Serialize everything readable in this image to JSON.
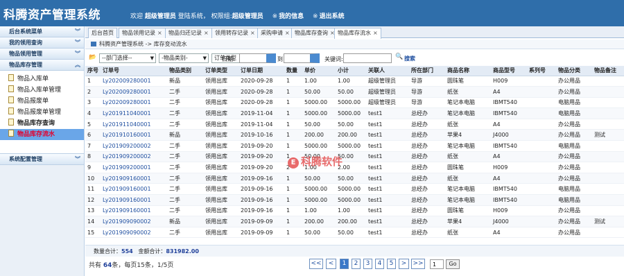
{
  "header": {
    "title": "科腾资产管理系统",
    "welcome": "欢迎",
    "username": "超级管理员",
    "login_text": "登陆系统，",
    "perm_label": "权限组:",
    "perm_group": "超级管理员",
    "my_info": "我的信息",
    "logout": "退出系统"
  },
  "sidebar": {
    "menus": [
      {
        "label": "后台系统菜单"
      },
      {
        "label": "我的领用查询"
      },
      {
        "label": "物品领用管理"
      },
      {
        "label": "物品库存管理"
      }
    ],
    "items": [
      {
        "label": "物品入库单"
      },
      {
        "label": "物品入库单管理"
      },
      {
        "label": "物品报废单"
      },
      {
        "label": "物品报废单管理"
      },
      {
        "label": "物品库存查询"
      },
      {
        "label": "物品库存流水"
      }
    ],
    "footer_menu": "系统配置管理"
  },
  "tabs": [
    "后台首页",
    "物品领用记录",
    "物品归还记录",
    "领用转存记录",
    "采购申请",
    "物品库存查询",
    "物品库存流水"
  ],
  "breadcrumb": "科腾资产管理系统 -> 库存变动流水",
  "filters": {
    "dept": "--部门选择--",
    "category": "-物品类别-",
    "order_type": "订单类型",
    "date_label": "日期:",
    "to_label": "到",
    "keyword_label": "关键词:",
    "search": "搜索"
  },
  "table": {
    "columns": [
      "序号",
      "订单号",
      "物品类别",
      "订单类型",
      "订单日期",
      "数量",
      "单价",
      "小计",
      "关联人",
      "所在部门",
      "商品名称",
      "商品型号",
      "系列号",
      "物品分类",
      "物品备注"
    ],
    "rows": [
      [
        "1",
        "Ly202009280001",
        "新品",
        "领用出库",
        "2020-09-28",
        "1",
        "1.00",
        "1.00",
        "超级管理员",
        "导游",
        "圆珠笔",
        "H009",
        "",
        "办公用品",
        ""
      ],
      [
        "2",
        "Ly202009280001",
        "二手",
        "领用出库",
        "2020-09-28",
        "1",
        "50.00",
        "50.00",
        "超级管理员",
        "导游",
        "纸张",
        "A4",
        "",
        "办公用品",
        ""
      ],
      [
        "3",
        "Ly202009280001",
        "二手",
        "领用出库",
        "2020-09-28",
        "1",
        "5000.00",
        "5000.00",
        "超级管理员",
        "导游",
        "笔记本电脑",
        "IBMT540",
        "",
        "电脑用品",
        ""
      ],
      [
        "4",
        "Ly201911040001",
        "二手",
        "领用出库",
        "2019-11-04",
        "1",
        "5000.00",
        "5000.00",
        "test1",
        "总经办",
        "笔记本电脑",
        "IBMT540",
        "",
        "电脑用品",
        ""
      ],
      [
        "5",
        "Ly201911040001",
        "二手",
        "领用出库",
        "2019-11-04",
        "1",
        "50.00",
        "50.00",
        "test1",
        "总经办",
        "纸张",
        "A4",
        "",
        "办公用品",
        ""
      ],
      [
        "6",
        "Ly201910160001",
        "新品",
        "领用出库",
        "2019-10-16",
        "1",
        "200.00",
        "200.00",
        "test1",
        "总经办",
        "苹果4",
        "J4000",
        "",
        "办公用品",
        "测试"
      ],
      [
        "7",
        "Ly201909200002",
        "二手",
        "领用出库",
        "2019-09-20",
        "1",
        "5000.00",
        "5000.00",
        "test1",
        "总经办",
        "笔记本电脑",
        "IBMT540",
        "",
        "电脑用品",
        ""
      ],
      [
        "8",
        "Ly201909200002",
        "二手",
        "领用出库",
        "2019-09-20",
        "1",
        "50.00",
        "50.00",
        "test1",
        "总经办",
        "纸张",
        "A4",
        "",
        "办公用品",
        ""
      ],
      [
        "9",
        "Ly201909200001",
        "二手",
        "领用出库",
        "2019-09-20",
        "2",
        "1.00",
        "2.00",
        "test1",
        "总经办",
        "圆珠笔",
        "H009",
        "",
        "办公用品",
        ""
      ],
      [
        "10",
        "Ly201909160001",
        "二手",
        "领用出库",
        "2019-09-16",
        "1",
        "50.00",
        "50.00",
        "test1",
        "总经办",
        "纸张",
        "A4",
        "",
        "办公用品",
        ""
      ],
      [
        "11",
        "Ly201909160001",
        "二手",
        "领用出库",
        "2019-09-16",
        "1",
        "5000.00",
        "5000.00",
        "test1",
        "总经办",
        "笔记本电脑",
        "IBMT540",
        "",
        "电脑用品",
        ""
      ],
      [
        "12",
        "Ly201909160001",
        "二手",
        "领用出库",
        "2019-09-16",
        "1",
        "5000.00",
        "5000.00",
        "test1",
        "总经办",
        "笔记本电脑",
        "IBMT540",
        "",
        "电脑用品",
        ""
      ],
      [
        "13",
        "Ly201909160001",
        "二手",
        "领用出库",
        "2019-09-16",
        "1",
        "1.00",
        "1.00",
        "test1",
        "总经办",
        "圆珠笔",
        "H009",
        "",
        "办公用品",
        ""
      ],
      [
        "14",
        "Ly201909090002",
        "新品",
        "领用出库",
        "2019-09-09",
        "1",
        "200.00",
        "200.00",
        "test1",
        "总经办",
        "苹果4",
        "J4000",
        "",
        "办公用品",
        "测试"
      ],
      [
        "15",
        "Ly201909090002",
        "二手",
        "领用出库",
        "2019-09-09",
        "1",
        "50.00",
        "50.00",
        "test1",
        "总经办",
        "纸张",
        "A4",
        "",
        "办公用品",
        ""
      ]
    ]
  },
  "totals": {
    "qty_label": "数量合计：",
    "qty_value": "554",
    "amount_label": "金额合计：",
    "amount_value": "831982.00"
  },
  "pager": {
    "info_prefix": "共有",
    "total": "64",
    "info_suffix": "条，每页15条，1/5页",
    "first": "<<",
    "prev": "<",
    "pages": [
      "1",
      "2",
      "3",
      "4",
      "5"
    ],
    "next": ">",
    "last": ">>",
    "page_input": "1",
    "go": "Go"
  },
  "watermark": {
    "icon": "E",
    "text": "科腾软件"
  }
}
